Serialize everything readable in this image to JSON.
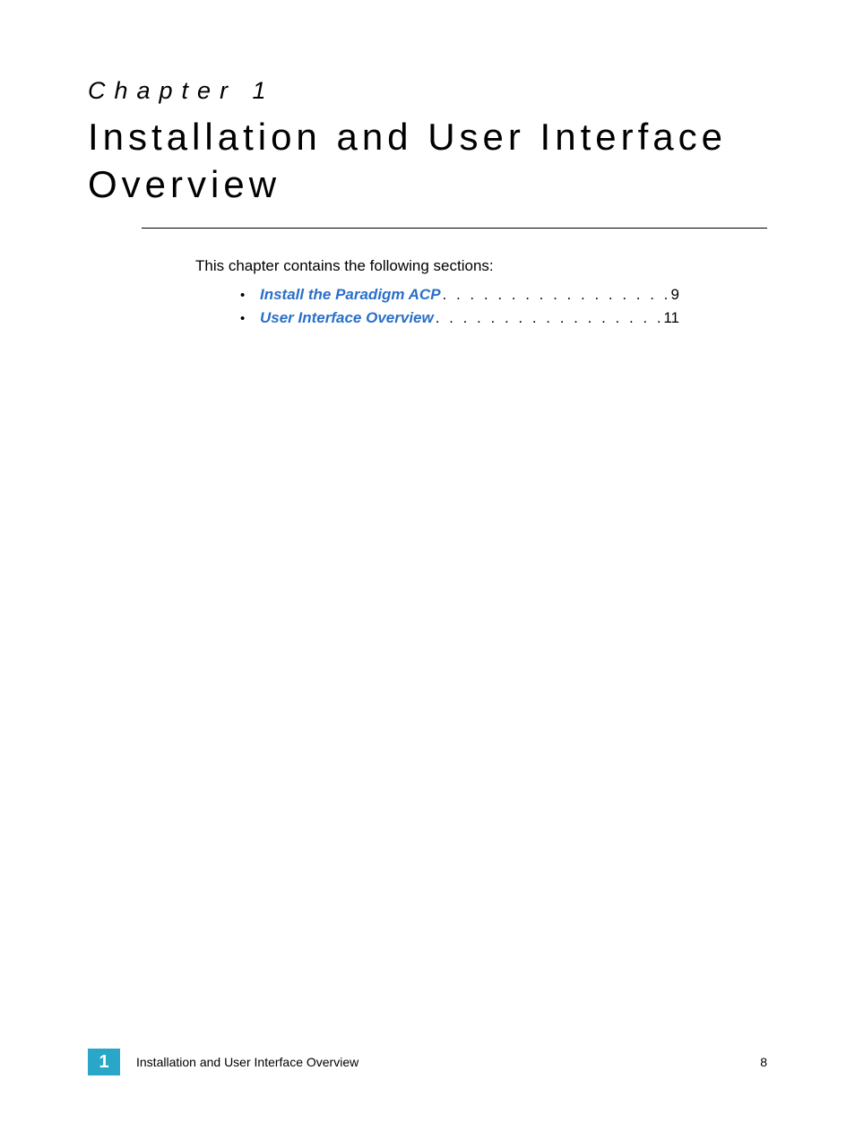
{
  "chapter": {
    "label": "Chapter 1",
    "title": "Installation and User Interface Overview"
  },
  "intro": "This chapter contains the following sections:",
  "toc": [
    {
      "label": "Install the Paradigm ACP",
      "page": "9"
    },
    {
      "label": "User Interface Overview",
      "page": "11"
    }
  ],
  "footer": {
    "chapter_number": "1",
    "chapter_title": "Installation and User Interface Overview",
    "page_number": "8"
  },
  "colors": {
    "link": "#2a6fc9",
    "badge": "#2aa6c9"
  }
}
